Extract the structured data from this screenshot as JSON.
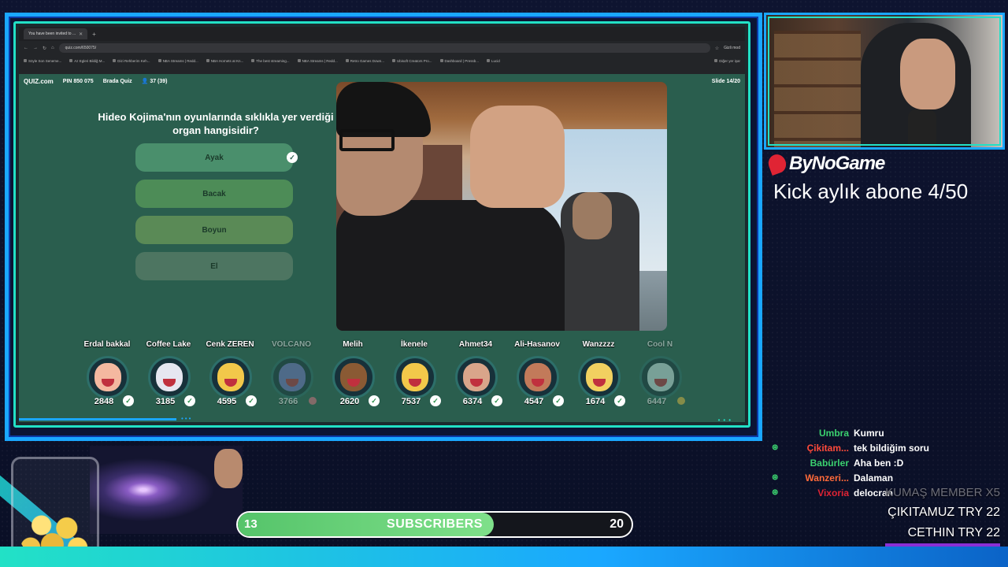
{
  "browser": {
    "tab_title": "You have been invited to ...",
    "url": "quiz.com/650075/",
    "incognito": "Gizli mod",
    "bookmarks": [
      "Söyle Son Seneme...",
      "Az Egleri Bildiğ M...",
      "Dizi Rehberim Keh...",
      "NBA Streams | Redd...",
      "NBA Hornets at Kn...",
      "The best streaming...",
      "NBA Streams | Redd...",
      "Retro Games Down...",
      "Ubisoft Creators Pro...",
      "Dashboard | Pressb...",
      "Lucid"
    ],
    "other_bookmarks": "Diğer yer işar"
  },
  "quiz": {
    "logo": "QUIZ.com",
    "pin": "PIN 850 075",
    "quiz_name": "Brada Quiz",
    "players_count": "37 (39)",
    "slide": "Slide 14/20",
    "question": "Hideo Kojima'nın oyunlarında sıklıkla yer verdiği organ hangisidir?",
    "answers": [
      {
        "label": "Ayak",
        "correct": true
      },
      {
        "label": "Bacak",
        "correct": false
      },
      {
        "label": "Boyun",
        "correct": false
      },
      {
        "label": "El",
        "correct": false
      }
    ],
    "players": [
      {
        "name": "Erdal bakkal",
        "score": "2848",
        "state": "ok",
        "face": "#f4b8a0"
      },
      {
        "name": "Coffee Lake",
        "score": "3185",
        "state": "ok",
        "face": "#e6e6f0"
      },
      {
        "name": "Cenk ZEREN",
        "score": "4595",
        "state": "ok",
        "face": "#f2c84a"
      },
      {
        "name": "VOLCANO",
        "score": "3766",
        "state": "wrong",
        "face": "#7a7ad0"
      },
      {
        "name": "Melih",
        "score": "2620",
        "state": "ok",
        "face": "#8a5a34"
      },
      {
        "name": "İkenele",
        "score": "7537",
        "state": "ok",
        "face": "#f2c84a"
      },
      {
        "name": "Ahmet34",
        "score": "6374",
        "state": "ok",
        "face": "#d9a58a"
      },
      {
        "name": "Ali-Hasanov",
        "score": "4547",
        "state": "ok",
        "face": "#c27a5a"
      },
      {
        "name": "Wanzzzz",
        "score": "1674",
        "state": "ok",
        "face": "#f2d060"
      },
      {
        "name": "Cool N",
        "score": "6447",
        "state": "pending",
        "face": "#d8f0f0"
      }
    ]
  },
  "overlay": {
    "brand": "ByNoGame",
    "kick_goal": "Kick aylık abone 4/50",
    "subscribers": {
      "label": "SUBSCRIBERS",
      "current": "13",
      "goal": "20",
      "fraction": 0.65
    }
  },
  "chat": [
    {
      "user": "Umbra",
      "msg": "Kumru",
      "color": "#3bd16f",
      "badge": false
    },
    {
      "user": "Çikitam...",
      "msg": "tek bildiğim soru",
      "color": "#ff4a3a",
      "badge": true
    },
    {
      "user": "Babürler",
      "msg": "Aha ben :D",
      "color": "#3bd16f",
      "badge": false
    },
    {
      "user": "Wanzeri...",
      "msg": "Dalaman",
      "color": "#ff6a3a",
      "badge": true
    },
    {
      "user": "Vixoria",
      "msg": "delocran",
      "color": "#e02434",
      "badge": true
    }
  ],
  "events": [
    {
      "text": "KUMAŞ  MEMBER X5",
      "style": "dim"
    },
    {
      "text": "ÇIKITAMUZ  TRY 22",
      "style": "normal"
    },
    {
      "text": "CETHIN  TRY 22",
      "style": "normal"
    },
    {
      "text": "CETHIN  TRY 22",
      "style": "hl"
    }
  ]
}
